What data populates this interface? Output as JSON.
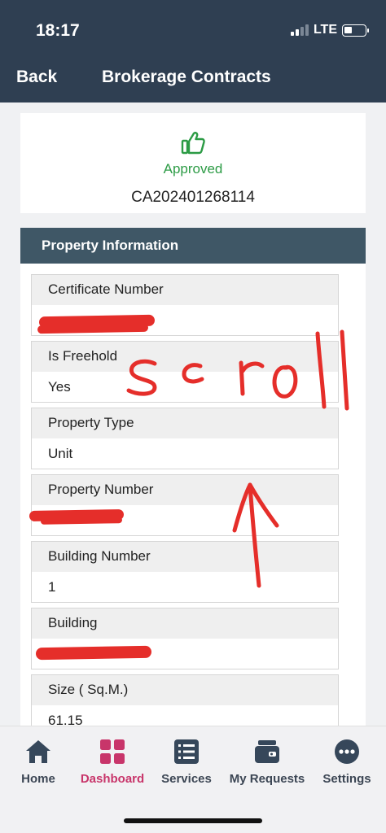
{
  "status_bar": {
    "time": "18:17",
    "network": "LTE"
  },
  "nav": {
    "back_label": "Back",
    "title": "Brokerage Contracts"
  },
  "status_card": {
    "status": "Approved",
    "reference": "CA202401268114",
    "icon": "thumbs-up-icon",
    "status_color": "#2c9b45"
  },
  "section": {
    "title": "Property Information",
    "fields": [
      {
        "label": "Certificate Number",
        "value": ""
      },
      {
        "label": "Is Freehold",
        "value": "Yes"
      },
      {
        "label": "Property Type",
        "value": "Unit"
      },
      {
        "label": "Property Number",
        "value": ""
      },
      {
        "label": "Building Number",
        "value": "1"
      },
      {
        "label": "Building",
        "value": ""
      },
      {
        "label": "Size ( Sq.M.)",
        "value": "61.15"
      }
    ]
  },
  "annotation": {
    "text": "scroll",
    "color": "#e52e2a"
  },
  "tabbar": {
    "items": [
      {
        "label": "Home",
        "icon": "home-icon"
      },
      {
        "label": "Dashboard",
        "icon": "dashboard-icon",
        "active": true
      },
      {
        "label": "Services",
        "icon": "list-icon"
      },
      {
        "label": "My Requests",
        "icon": "wallet-icon"
      },
      {
        "label": "Settings",
        "icon": "more-icon"
      }
    ],
    "active_color": "#c8356a"
  }
}
